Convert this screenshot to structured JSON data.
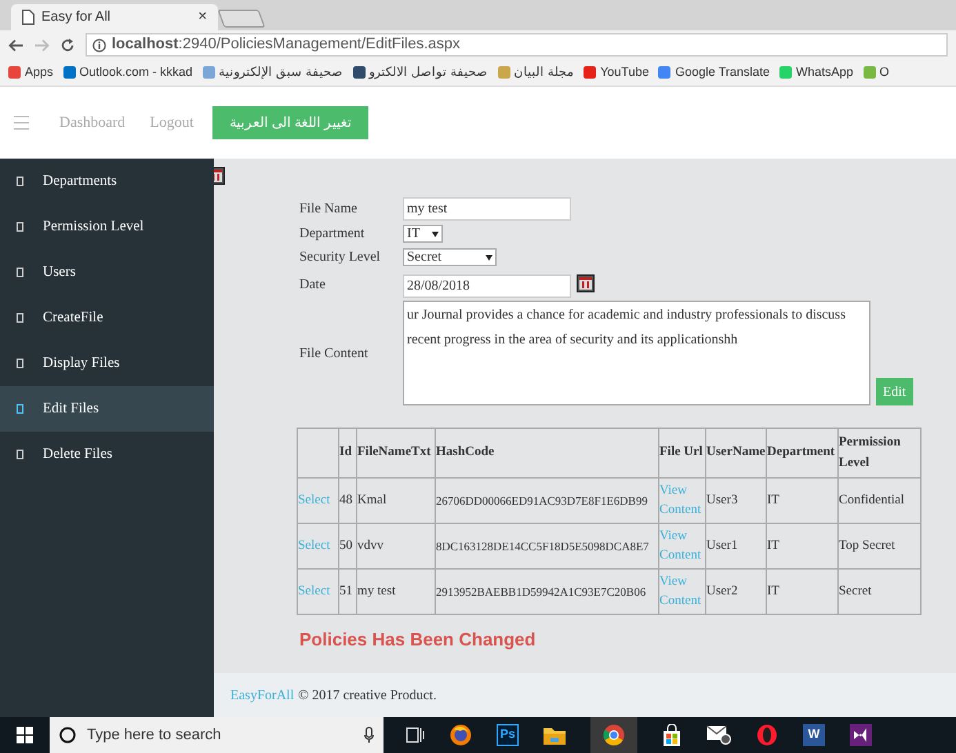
{
  "browser": {
    "tab_title": "Easy for All",
    "tab_close": "×",
    "url": "**localhost**:2940/PoliciesManagement/EditFiles.aspx",
    "bookmarks": [
      {
        "label": "Apps",
        "color": "#e8453c"
      },
      {
        "label": "Outlook.com - kkkad",
        "color": "#0072c6"
      },
      {
        "label": "صحيفة سبق الإلكترونية",
        "color": "#7aa6d8"
      },
      {
        "label": "صحيفة تواصل الالكترو",
        "color": "#2f4a6b"
      },
      {
        "label": "مجلة البيان",
        "color": "#c9a74a"
      },
      {
        "label": "YouTube",
        "color": "#e62117"
      },
      {
        "label": "Google Translate",
        "color": "#4285f4"
      },
      {
        "label": "WhatsApp",
        "color": "#25d366"
      },
      {
        "label": "O",
        "color": "#78b843"
      }
    ]
  },
  "nav": {
    "items": [
      "Dashboard",
      "Logout"
    ],
    "language_button": "تغيير اللغة الى العربية"
  },
  "sidebar": {
    "items": [
      {
        "label": "Departments",
        "selected": false
      },
      {
        "label": "Permission Level",
        "selected": false
      },
      {
        "label": "Users",
        "selected": false
      },
      {
        "label": "CreateFile",
        "selected": false
      },
      {
        "label": "Display Files",
        "selected": false
      },
      {
        "label": "Edit Files",
        "selected": true
      },
      {
        "label": "Delete Files",
        "selected": false
      }
    ]
  },
  "form": {
    "fields": [
      {
        "kind": "text",
        "label": "File Name",
        "value": "my test"
      },
      {
        "kind": "select",
        "label": "Department",
        "value": "IT"
      },
      {
        "kind": "select",
        "label": "Security Level",
        "value": "Secret"
      },
      {
        "kind": "date",
        "label": "Date",
        "value": "28/08/2018"
      },
      {
        "kind": "textarea",
        "label": "File Content",
        "value": "ur Journal provides a chance for academic and industry professionals to discuss recent progress in the area of security and its applicationshh"
      }
    ],
    "edit_button": "Edit"
  },
  "table": {
    "columns": [
      "Id",
      "FileNameTxt",
      "HashCode",
      "File Url",
      "UserName",
      "Department",
      "Permission Level"
    ],
    "rows": [
      {
        "select": "Select",
        "id": "48",
        "name": "Kmal",
        "hash": "26706DD00066ED91AC93D7E8F1E6DB99",
        "file_url": "View Content",
        "user": "User3",
        "department": "IT",
        "level": "Confidential"
      },
      {
        "select": "Select",
        "id": "50",
        "name": "vdvv",
        "hash": "8DC163128DE14CC5F18D5E5098DCA8E7",
        "file_url": "View Content",
        "user": "User1",
        "department": "IT",
        "level": "Top Secret"
      },
      {
        "select": "Select",
        "id": "51",
        "name": "my test",
        "hash": "2913952BAEBB1D59942A1C93E7C20B06",
        "file_url": "View Content",
        "user": "User2",
        "department": "IT",
        "level": "Secret"
      }
    ]
  },
  "message": "Policies Has Been Changed",
  "footer": {
    "brand": "EasyForAll",
    "text": "© 2017 creative Product."
  },
  "taskbar": {
    "search_placeholder": "Type here to search",
    "apps": [
      {
        "kind": "taskview"
      },
      {
        "kind": "firefox"
      },
      {
        "kind": "photoshop",
        "label": "Ps"
      },
      {
        "kind": "folder"
      },
      {
        "kind": "chrome"
      },
      {
        "kind": "store"
      },
      {
        "kind": "mail"
      },
      {
        "kind": "opera"
      },
      {
        "kind": "word",
        "label": "W"
      },
      {
        "kind": "vs"
      }
    ]
  }
}
